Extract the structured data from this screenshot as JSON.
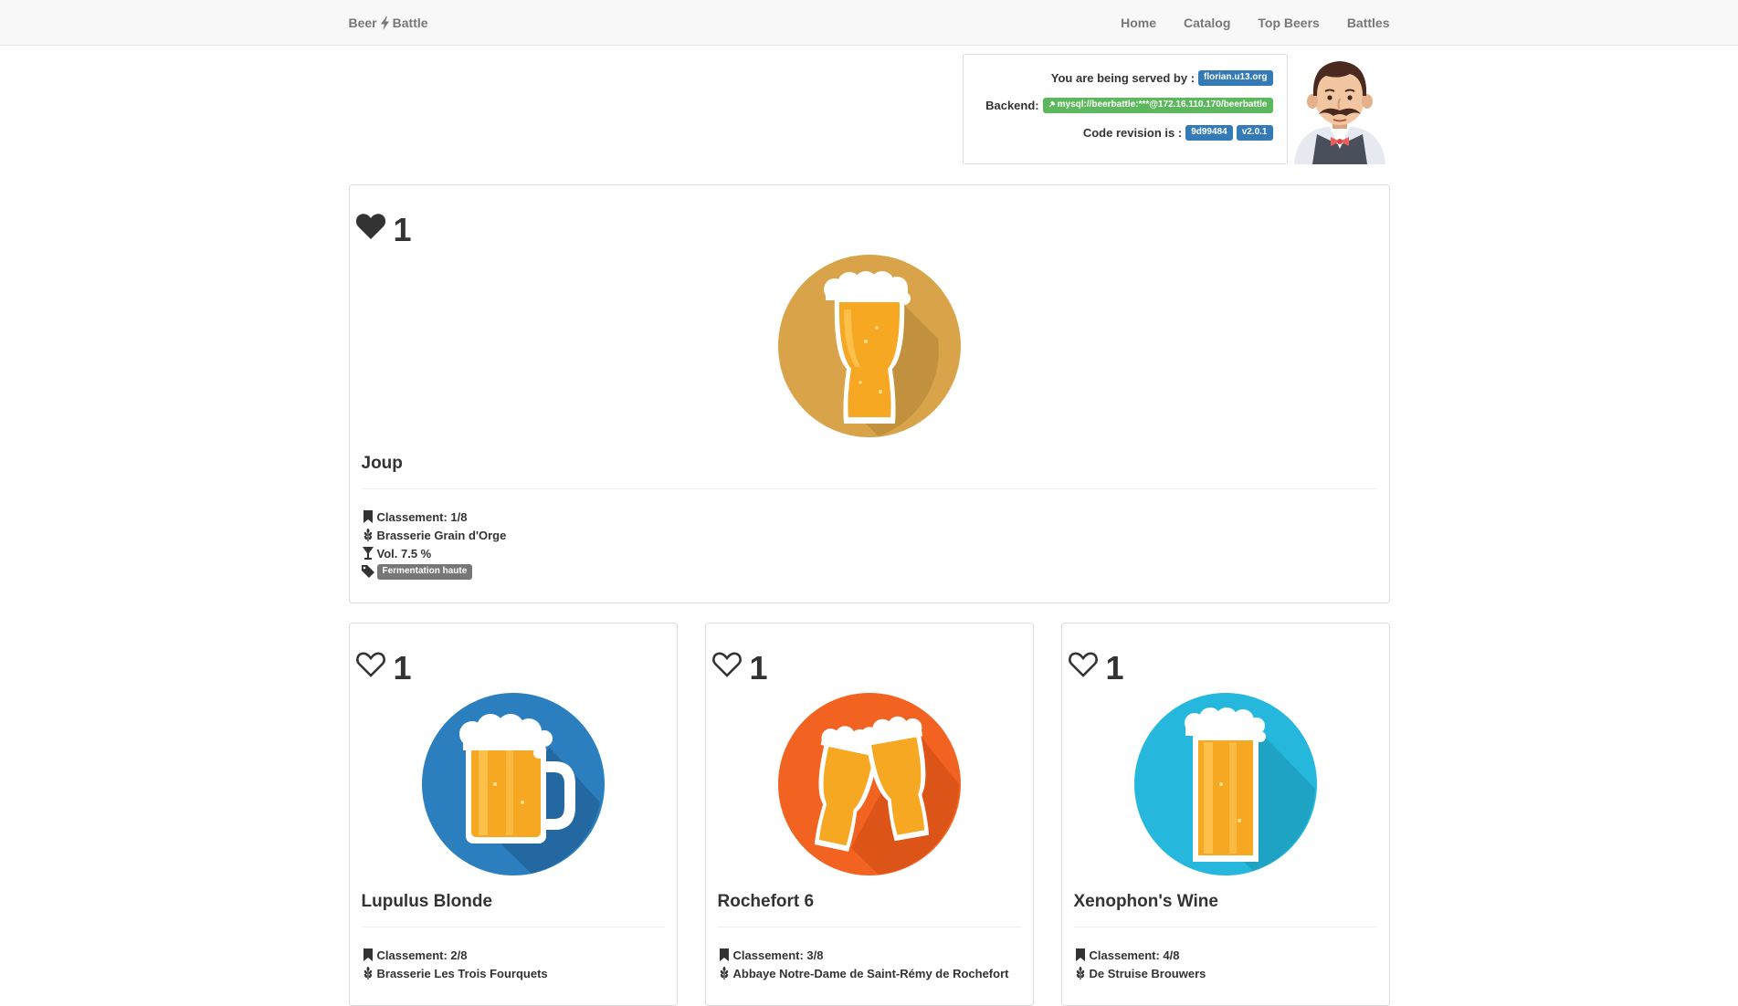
{
  "nav": {
    "brand_left": "Beer",
    "brand_right": "Battle",
    "links": [
      "Home",
      "Catalog",
      "Top Beers",
      "Battles"
    ]
  },
  "server": {
    "served_label": "You are being served by :",
    "served_value": "florian.u13.org",
    "backend_label": "Backend:",
    "backend_value": "mysql://beerbattle:***@172.16.110.170/beerbattle",
    "revision_label": "Code revision is :",
    "revision_hash": "9d99484",
    "revision_version": "v2.0.1"
  },
  "featured": {
    "likes": "1",
    "liked": true,
    "name": "Joup",
    "rank": "Classement: 1/8",
    "brewery": "Brasserie Grain d'Orge",
    "abv": "Vol. 7.5 %",
    "tag": "Fermentation haute",
    "image": "tall-glass-icon",
    "color": "#d9a34a"
  },
  "beers": [
    {
      "likes": "1",
      "liked": false,
      "name": "Lupulus Blonde",
      "rank": "Classement: 2/8",
      "brewery": "Brasserie Les Trois Fourquets",
      "image": "mug-icon",
      "color": "#2b7fbf"
    },
    {
      "likes": "1",
      "liked": false,
      "name": "Rochefort 6",
      "rank": "Classement: 3/8",
      "brewery": "Abbaye Notre-Dame de Saint-Rémy de Rochefort",
      "image": "cheers-icon",
      "color": "#f26322"
    },
    {
      "likes": "1",
      "liked": false,
      "name": "Xenophon's Wine",
      "rank": "Classement: 4/8",
      "brewery": "De Struise Brouwers",
      "image": "pint-glass-icon",
      "color": "#26b8dc"
    }
  ],
  "colors": {
    "primary_label": "#337ab7",
    "success_label": "#5cb85c",
    "default_label": "#777777",
    "navbar_bg": "#f8f8f8"
  }
}
